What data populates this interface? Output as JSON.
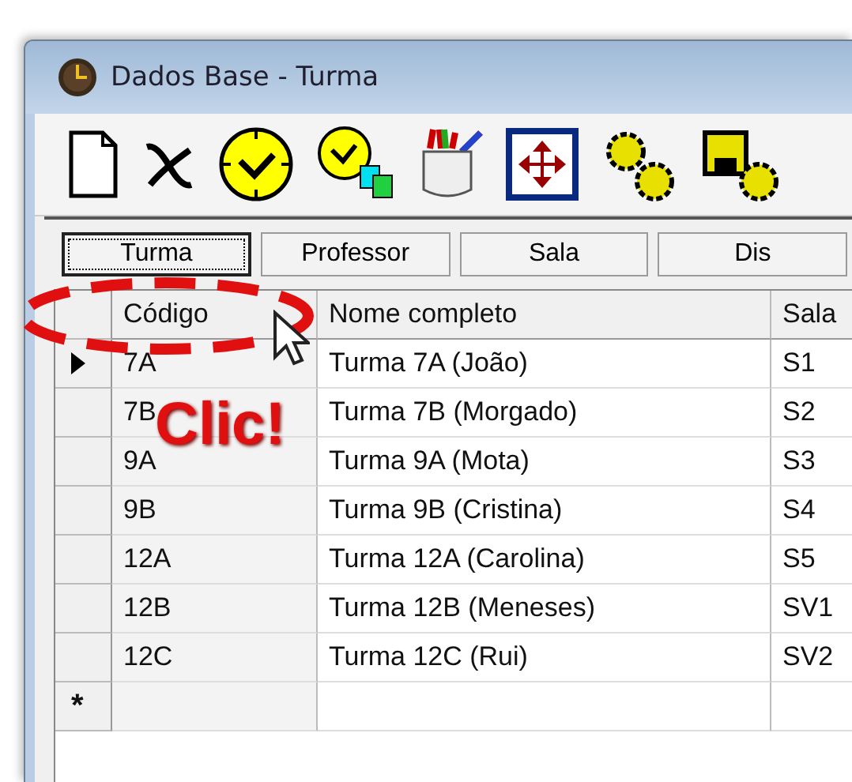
{
  "window": {
    "title": "Dados Base - Turma"
  },
  "tabs": [
    {
      "label": "Turma",
      "selected": true
    },
    {
      "label": "Professor",
      "selected": false
    },
    {
      "label": "Sala",
      "selected": false
    },
    {
      "label": "Dis",
      "selected": false
    }
  ],
  "grid": {
    "columns": [
      "Código",
      "Nome completo",
      "Sala"
    ],
    "rows": [
      {
        "current": true,
        "cells": [
          "7A",
          "Turma 7A (João)",
          "S1"
        ]
      },
      {
        "current": false,
        "cells": [
          "7B",
          "Turma 7B (Morgado)",
          "S2"
        ]
      },
      {
        "current": false,
        "cells": [
          "9A",
          "Turma 9A (Mota)",
          "S3"
        ]
      },
      {
        "current": false,
        "cells": [
          "9B",
          "Turma 9B (Cristina)",
          "S4"
        ]
      },
      {
        "current": false,
        "cells": [
          "12A",
          "Turma 12A (Carolina)",
          "S5"
        ]
      },
      {
        "current": false,
        "cells": [
          "12B",
          "Turma 12B (Meneses)",
          "SV1"
        ]
      },
      {
        "current": false,
        "cells": [
          "12C",
          "Turma 12C (Rui)",
          "SV2"
        ]
      }
    ],
    "new_row_marker": "*"
  },
  "annotation": {
    "text": "Clic!"
  }
}
